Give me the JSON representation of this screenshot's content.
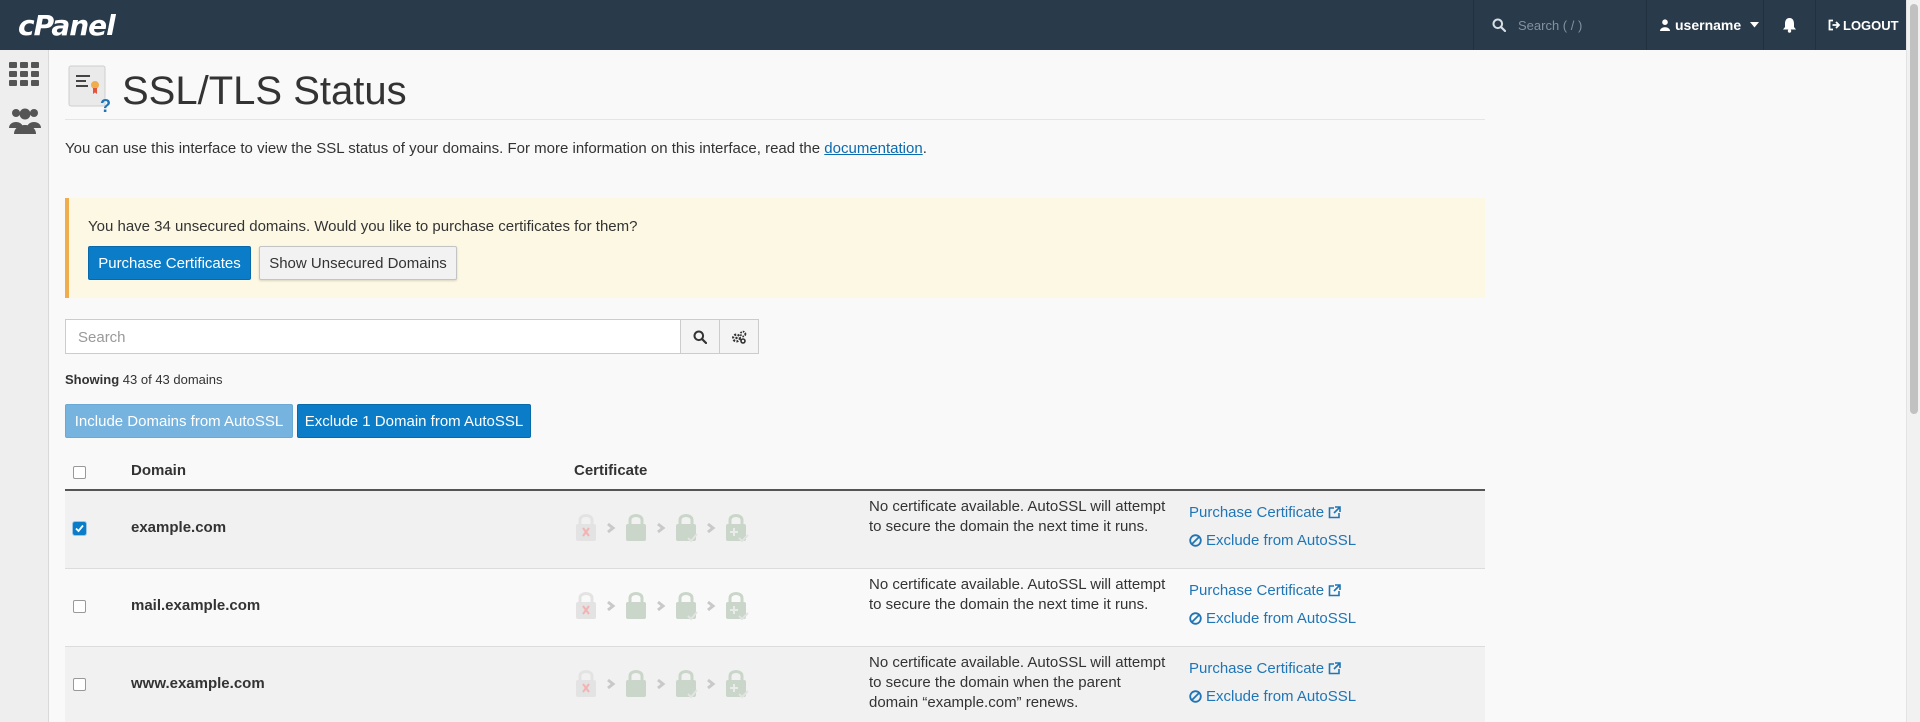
{
  "topbar": {
    "logo": "cPanel",
    "search_placeholder": "Search ( / )",
    "username": "username",
    "logout": "LOGOUT"
  },
  "page": {
    "title": "SSL/TLS Status",
    "intro_text": "You can use this interface to view the SSL status of your domains. For more information on this interface, read the ",
    "intro_link": "documentation",
    "intro_end": "."
  },
  "alert": {
    "message": "You have 34 unsecured domains. Would you like to purchase certificates for them?",
    "purchase_label": "Purchase Certificates",
    "show_unsecured_label": "Show Unsecured Domains"
  },
  "search": {
    "placeholder": "Search"
  },
  "showing": {
    "label": "Showing",
    "text": "43 of 43 domains"
  },
  "bulk_actions": {
    "include_label": "Include Domains from AutoSSL",
    "exclude_label": "Exclude 1 Domain from AutoSSL"
  },
  "table": {
    "headers": [
      "Domain",
      "Certificate"
    ],
    "rows": [
      {
        "domain": "example.com",
        "checked": true,
        "note": "No certificate available. AutoSSL will attempt to secure the domain the next time it runs.",
        "purchase": "Purchase Certificate",
        "exclude": "Exclude from AutoSSL"
      },
      {
        "domain": "mail.example.com",
        "checked": false,
        "note": "No certificate available. AutoSSL will attempt to secure the domain the next time it runs.",
        "purchase": "Purchase Certificate",
        "exclude": "Exclude from AutoSSL"
      },
      {
        "domain": "www.example.com",
        "checked": false,
        "note": "No certificate available. AutoSSL will attempt to secure the domain when the parent domain “example.com” renews.",
        "purchase": "Purchase Certificate",
        "exclude": "Exclude from AutoSSL"
      }
    ]
  },
  "colors": {
    "topbar": "#293a4a",
    "primary": "#0b7cc7",
    "link": "#1f75b5",
    "alert_bg": "#fcf8e3",
    "alert_border": "#f0ad4e"
  },
  "icons": {
    "rail": [
      "grid-icon",
      "users-icon"
    ],
    "cert_status": [
      "lock-invalid-icon",
      "lock-icon",
      "lock-check-icon",
      "lock-plus-icon"
    ]
  }
}
